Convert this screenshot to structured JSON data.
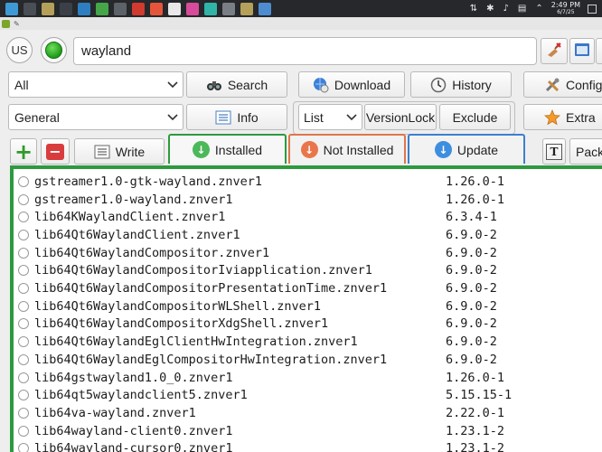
{
  "taskbar": {
    "apps": [
      {
        "icon": "menu-icon",
        "color": "#3d9ad6"
      },
      {
        "icon": "desktop-icon",
        "color": "#4a4e55"
      },
      {
        "icon": "package-manager-icon",
        "color": "#b5a05a"
      },
      {
        "icon": "terminal-icon",
        "color": "#3b4048"
      },
      {
        "icon": "file-manager-icon",
        "color": "#2d7fc1"
      },
      {
        "icon": "text-editor-icon",
        "color": "#45a649"
      },
      {
        "icon": "media-player-icon",
        "color": "#5d6168"
      },
      {
        "icon": "record-icon",
        "color": "#d13a2f"
      },
      {
        "icon": "brave-browser-icon",
        "color": "#e5553a"
      },
      {
        "icon": "document-icon",
        "color": "#e8e8e8"
      },
      {
        "icon": "color-picker-icon",
        "color": "#d84b9a"
      },
      {
        "icon": "monitor-icon",
        "color": "#31b4a8"
      },
      {
        "icon": "app-icon",
        "color": "#7a7f86"
      },
      {
        "icon": "package-manager-icon",
        "color": "#b5a05a"
      },
      {
        "icon": "folder-icon",
        "color": "#4e8cd0"
      }
    ],
    "time": "2:49 PM",
    "date": "6/7/25"
  },
  "toolbar": {
    "lang_label": "US",
    "search_value": "wayland",
    "filter_select": "All",
    "search_button": "Search",
    "download_button": "Download",
    "history_button": "History",
    "config_button": "Config",
    "category_select": "General",
    "info_button": "Info",
    "view_select": "List",
    "versionlock_button": "VersionLock",
    "exclude_button": "Exclude",
    "extra_button": "Extra",
    "add_label": "+",
    "remove_label": "−",
    "write_button": "Write",
    "pack_button": "Pack"
  },
  "tabs": [
    {
      "label": "Installed",
      "border": "#2e9a3f",
      "circle": "#4bb85a"
    },
    {
      "label": "Not Installed",
      "border": "#e0764a",
      "circle": "#e9764b"
    },
    {
      "label": "Update",
      "border": "#3b7fd0",
      "circle": "#3d8ee0"
    }
  ],
  "packages": [
    {
      "name": "gstreamer1.0-gtk-wayland.znver1",
      "version": "1.26.0-1"
    },
    {
      "name": "gstreamer1.0-wayland.znver1",
      "version": "1.26.0-1"
    },
    {
      "name": "lib64KWaylandClient.znver1",
      "version": "6.3.4-1"
    },
    {
      "name": "lib64Qt6WaylandClient.znver1",
      "version": "6.9.0-2"
    },
    {
      "name": "lib64Qt6WaylandCompositor.znver1",
      "version": "6.9.0-2"
    },
    {
      "name": "lib64Qt6WaylandCompositorIviapplication.znver1",
      "version": "6.9.0-2"
    },
    {
      "name": "lib64Qt6WaylandCompositorPresentationTime.znver1",
      "version": "6.9.0-2"
    },
    {
      "name": "lib64Qt6WaylandCompositorWLShell.znver1",
      "version": "6.9.0-2"
    },
    {
      "name": "lib64Qt6WaylandCompositorXdgShell.znver1",
      "version": "6.9.0-2"
    },
    {
      "name": "lib64Qt6WaylandEglClientHwIntegration.znver1",
      "version": "6.9.0-2"
    },
    {
      "name": "lib64Qt6WaylandEglCompositorHwIntegration.znver1",
      "version": "6.9.0-2"
    },
    {
      "name": "lib64gstwayland1.0_0.znver1",
      "version": "1.26.0-1"
    },
    {
      "name": "lib64qt5waylandclient5.znver1",
      "version": "5.15.15-1"
    },
    {
      "name": "lib64va-wayland.znver1",
      "version": "2.22.0-1"
    },
    {
      "name": "lib64wayland-client0.znver1",
      "version": "1.23.1-2"
    },
    {
      "name": "lib64wayland-cursor0.znver1",
      "version": "1.23.1-2"
    }
  ]
}
